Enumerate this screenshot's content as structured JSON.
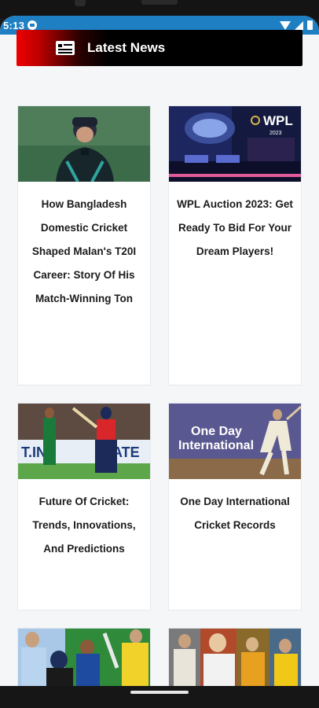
{
  "status_bar": {
    "time": "5:13"
  },
  "header": {
    "title": "Latest News"
  },
  "articles": [
    {
      "title": "How Bangladesh Domestic Cricket Shaped Malan's T20I Career: Story Of His Match-Winning Ton",
      "image_text": ""
    },
    {
      "title": "WPL Auction 2023: Get Ready To Bid For Your Dream Players!",
      "image_text": "WPL 2023"
    },
    {
      "title": "Future Of Cricket: Trends, Innovations, And Predictions",
      "image_text": "T.IN ... STATE"
    },
    {
      "title": "One Day International Cricket Records",
      "image_text": "One Day International"
    },
    {
      "title": "",
      "image_text": ""
    },
    {
      "title": "",
      "image_text": ""
    }
  ],
  "colors": {
    "status_bar": "#1f7fc3",
    "header_red": "#ef0000",
    "header_black": "#000000",
    "background": "#f4f6f8"
  }
}
